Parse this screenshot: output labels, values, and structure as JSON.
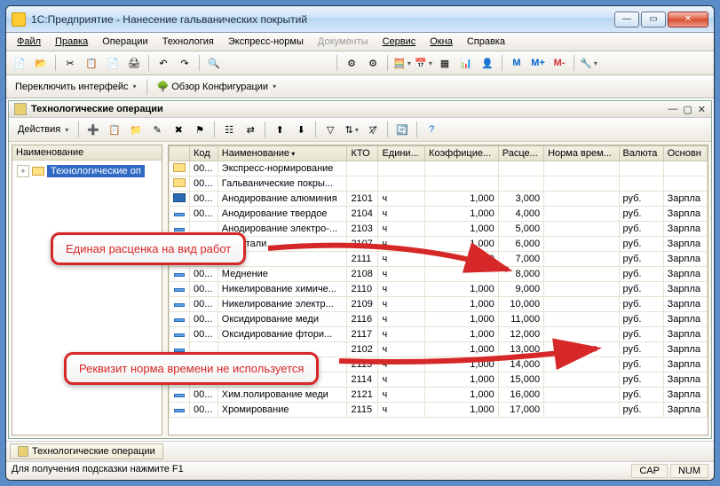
{
  "window": {
    "title": "1С:Предприятие - Нанесение гальванических покрытий"
  },
  "menu": [
    "Файл",
    "Правка",
    "Операции",
    "Технология",
    "Экспресс-нормы",
    "Документы",
    "Сервис",
    "Окна",
    "Справка"
  ],
  "menu_disabled_index": 5,
  "toolbar2": {
    "switch_interface": "Переключить интерфейс",
    "config_overview": "Обзор Конфигурации"
  },
  "inner": {
    "title": "Технологические операции",
    "actions_label": "Действия"
  },
  "tree": {
    "header": "Наименование",
    "root": "Технологические оп"
  },
  "columns": [
    "",
    "Код",
    "Наименование",
    "КТО",
    "Едини...",
    "Коэффицие...",
    "Расце...",
    "Норма врем...",
    "Валюта",
    "Основн"
  ],
  "rows": [
    {
      "t": "folder",
      "code": "00...",
      "name": "Экспресс-нормирование",
      "kto": "",
      "unit": "",
      "coef": "",
      "rate": "",
      "norm": "",
      "cur": "",
      "base": ""
    },
    {
      "t": "folder",
      "code": "00...",
      "name": "Гальванические покры...",
      "kto": "",
      "unit": "",
      "coef": "",
      "rate": "",
      "norm": "",
      "cur": "",
      "base": ""
    },
    {
      "t": "sel",
      "code": "00...",
      "name": "Анодирование алюминия",
      "kto": "2101",
      "unit": "ч",
      "coef": "1,000",
      "rate": "3,000",
      "norm": "",
      "cur": "руб.",
      "base": "Зарпла"
    },
    {
      "t": "item",
      "code": "00...",
      "name": "Анодирование твердое",
      "kto": "2104",
      "unit": "ч",
      "coef": "1,000",
      "rate": "4,000",
      "norm": "",
      "cur": "руб.",
      "base": "Зарпла"
    },
    {
      "t": "item",
      "code": "",
      "name": "Анодирование электро-...",
      "kto": "2103",
      "unit": "ч",
      "coef": "1,000",
      "rate": "5,000",
      "norm": "",
      "cur": "руб.",
      "base": "Зарпла"
    },
    {
      "t": "item",
      "code": "",
      "name": "ние стали",
      "kto": "2107",
      "unit": "ч",
      "coef": "1,000",
      "rate": "6,000",
      "norm": "",
      "cur": "руб.",
      "base": "Зарпла"
    },
    {
      "t": "item",
      "code": "",
      "name": "",
      "kto": "2111",
      "unit": "ч",
      "coef": "1,000",
      "rate": "7,000",
      "norm": "",
      "cur": "руб.",
      "base": "Зарпла"
    },
    {
      "t": "item",
      "code": "00...",
      "name": "Меднение",
      "kto": "2108",
      "unit": "ч",
      "coef": "",
      "rate": "8,000",
      "norm": "",
      "cur": "руб.",
      "base": "Зарпла"
    },
    {
      "t": "item",
      "code": "00...",
      "name": "Никелирование химиче...",
      "kto": "2110",
      "unit": "ч",
      "coef": "1,000",
      "rate": "9,000",
      "norm": "",
      "cur": "руб.",
      "base": "Зарпла"
    },
    {
      "t": "item",
      "code": "00...",
      "name": "Никелирование электр...",
      "kto": "2109",
      "unit": "ч",
      "coef": "1,000",
      "rate": "10,000",
      "norm": "",
      "cur": "руб.",
      "base": "Зарпла"
    },
    {
      "t": "item",
      "code": "00...",
      "name": "Оксидирование меди",
      "kto": "2116",
      "unit": "ч",
      "coef": "1,000",
      "rate": "11,000",
      "norm": "",
      "cur": "руб.",
      "base": "Зарпла"
    },
    {
      "t": "item",
      "code": "00...",
      "name": "Оксидирование фтори...",
      "kto": "2117",
      "unit": "ч",
      "coef": "1,000",
      "rate": "12,000",
      "norm": "",
      "cur": "руб.",
      "base": "Зарпла"
    },
    {
      "t": "item",
      "code": "",
      "name": "",
      "kto": "2102",
      "unit": "ч",
      "coef": "1,000",
      "rate": "13,000",
      "norm": "",
      "cur": "руб.",
      "base": "Зарпла"
    },
    {
      "t": "item",
      "code": "",
      "name": "",
      "kto": "2113",
      "unit": "ч",
      "coef": "1,000",
      "rate": "14,000",
      "norm": "",
      "cur": "руб.",
      "base": "Зарпла"
    },
    {
      "t": "item",
      "code": "",
      "name": "",
      "kto": "2114",
      "unit": "ч",
      "coef": "1,000",
      "rate": "15,000",
      "norm": "",
      "cur": "руб.",
      "base": "Зарпла"
    },
    {
      "t": "item",
      "code": "00...",
      "name": "Хим.полирование меди",
      "kto": "2121",
      "unit": "ч",
      "coef": "1,000",
      "rate": "16,000",
      "norm": "",
      "cur": "руб.",
      "base": "Зарпла"
    },
    {
      "t": "item",
      "code": "00...",
      "name": "Хромирование",
      "kto": "2115",
      "unit": "ч",
      "coef": "1,000",
      "rate": "17,000",
      "norm": "",
      "cur": "руб.",
      "base": "Зарпла"
    }
  ],
  "taskbar_tab": "Технологические операции",
  "status": {
    "hint": "Для получения подсказки нажмите F1",
    "cap": "CAP",
    "num": "NUM"
  },
  "callouts": {
    "c1": "Единая расценка на вид работ",
    "c2": "Реквизит норма времени не используется"
  }
}
